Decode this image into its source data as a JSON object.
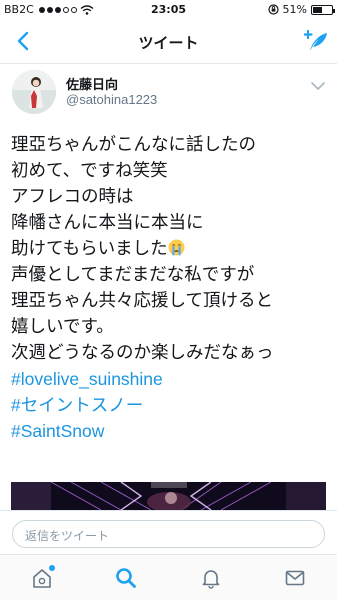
{
  "status_bar": {
    "carrier": "BB2C",
    "time": "23:05",
    "battery": "51%",
    "battery_level": 0.51,
    "signal_bars_filled": 3
  },
  "nav": {
    "title": "ツイート",
    "back_icon": "chevron-left-icon",
    "compose_icon": "compose-tweet-icon"
  },
  "tweet": {
    "author_name": "佐藤日向",
    "author_handle": "@satohina1223",
    "lines": [
      "理亞ちゃんがこんなに話したの",
      "初めて、ですね笑笑",
      "アフレコの時は",
      "降幡さんに本当に本当に",
      "助けてもらいました",
      "声優としてまだまだな私ですが",
      "理亞ちゃん共々応援して頂けると",
      "嬉しいです。",
      "次週どうなるのか楽しみだなぁっ"
    ],
    "hashtags": [
      "#lovelive_suinshine",
      "#セイントスノー",
      "#SaintSnow"
    ]
  },
  "reply": {
    "placeholder": "返信をツイート"
  },
  "tabbar": {
    "items": [
      "home-icon",
      "search-icon",
      "notifications-icon",
      "messages-icon"
    ],
    "active": "search-icon"
  },
  "colors": {
    "accent": "#1da1f2",
    "hashtag": "#1b95e0",
    "secondary_text": "#657786"
  }
}
